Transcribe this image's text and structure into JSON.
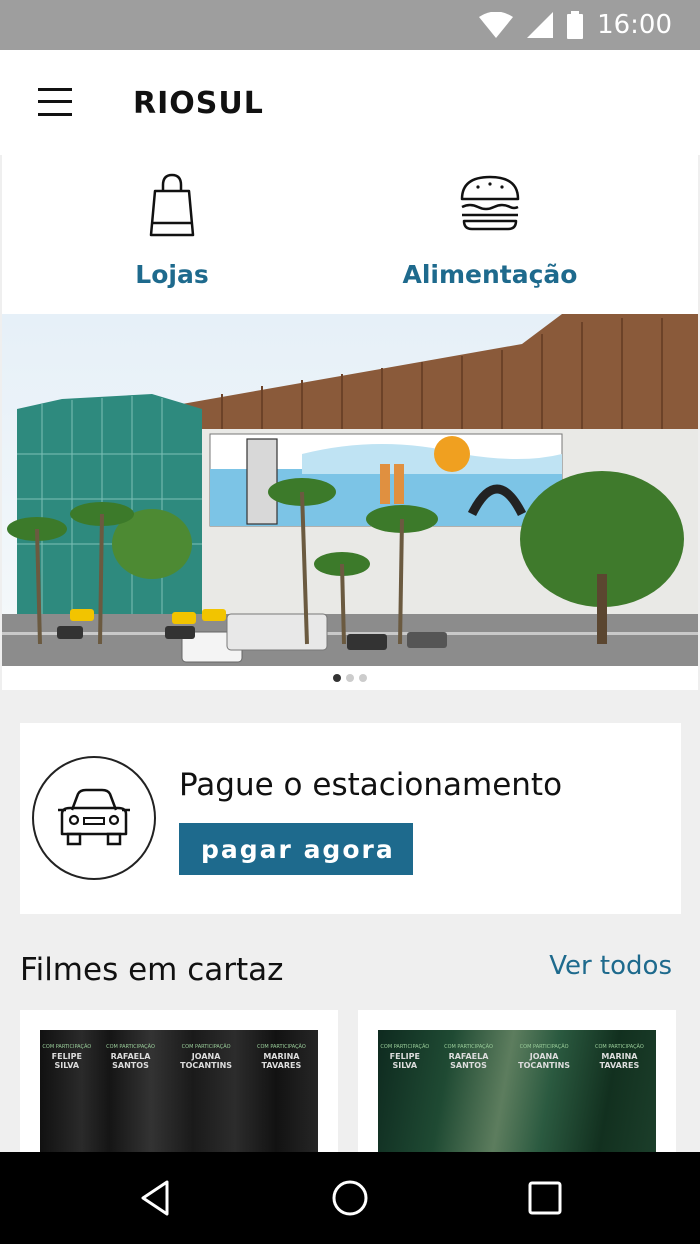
{
  "status_bar": {
    "time": "16:00",
    "icons": [
      "wifi-icon",
      "signal-icon",
      "battery-icon"
    ]
  },
  "app_bar": {
    "title": "RIOSUL",
    "menu_icon": "hamburger-menu-icon"
  },
  "categories": [
    {
      "label": "Lojas",
      "icon": "shopping-bag-icon"
    },
    {
      "label": "Alimentação",
      "icon": "burger-icon"
    }
  ],
  "carousel": {
    "slides": 3,
    "active_index": 0
  },
  "parking": {
    "title": "Pague o estacionamento",
    "button": "pagar agora",
    "icon": "car-icon"
  },
  "movies": {
    "title": "Filmes em cartaz",
    "see_all": "Ver todos",
    "cards": [
      {
        "credits": [
          "FELIPE SILVA",
          "RAFAELA SANTOS",
          "JOANA TOCANTINS",
          "MARINA TAVARES"
        ],
        "credit_prefix": "COM PARTICIPAÇÃO"
      },
      {
        "credits": [
          "FELIPE SILVA",
          "RAFAELA SANTOS",
          "JOANA TOCANTINS",
          "MARINA TAVARES"
        ],
        "credit_prefix": "COM PARTICIPAÇÃO"
      }
    ]
  },
  "nav_bar": {
    "buttons": [
      "back-icon",
      "home-icon",
      "recents-icon"
    ]
  },
  "colors": {
    "accent": "#1e6a8d",
    "status_bar": "#9e9e9e",
    "background": "#efefef"
  }
}
